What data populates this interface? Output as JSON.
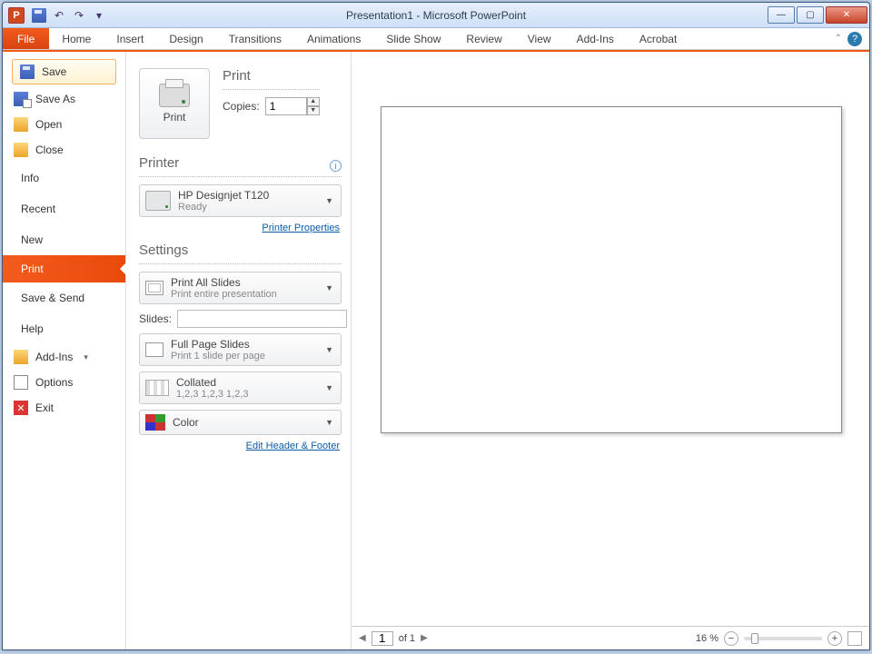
{
  "window": {
    "title": "Presentation1 - Microsoft PowerPoint"
  },
  "ribbon": {
    "file": "File",
    "tabs": [
      "Home",
      "Insert",
      "Design",
      "Transitions",
      "Animations",
      "Slide Show",
      "Review",
      "View",
      "Add-Ins",
      "Acrobat"
    ]
  },
  "sidebar": {
    "save": "Save",
    "save_as": "Save As",
    "open": "Open",
    "close": "Close",
    "info": "Info",
    "recent": "Recent",
    "new": "New",
    "print": "Print",
    "save_send": "Save & Send",
    "help": "Help",
    "addins": "Add-Ins",
    "options": "Options",
    "exit": "Exit"
  },
  "print": {
    "heading": "Print",
    "print_btn": "Print",
    "copies_label": "Copies:",
    "copies_value": "1",
    "printer_heading": "Printer",
    "printer_name": "HP Designjet T120",
    "printer_status": "Ready",
    "printer_props": "Printer Properties",
    "settings_heading": "Settings",
    "print_all": {
      "title": "Print All Slides",
      "sub": "Print entire presentation"
    },
    "slides_label": "Slides:",
    "slides_value": "",
    "full_page": {
      "title": "Full Page Slides",
      "sub": "Print 1 slide per page"
    },
    "collated": {
      "title": "Collated",
      "sub": "1,2,3   1,2,3   1,2,3"
    },
    "color": "Color",
    "header_footer": "Edit Header & Footer"
  },
  "status": {
    "page": "1",
    "of": "of 1",
    "zoom": "16 %"
  }
}
